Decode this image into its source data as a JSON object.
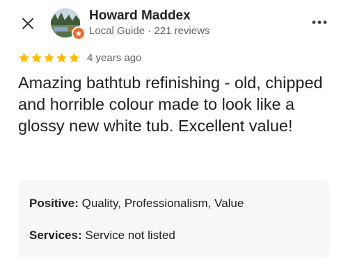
{
  "reviewer": {
    "name": "Howard Maddex",
    "meta": "Local Guide · 221 reviews"
  },
  "icons": {
    "close": "close-icon",
    "more": "more-vertical-icon",
    "badge": "local-guide-badge-icon",
    "star": "star-icon"
  },
  "colors": {
    "star": "#fbbc04",
    "badge": "#ee6a2b",
    "card_bg": "#f7f8f8"
  },
  "review": {
    "rating": 5,
    "max_rating": 5,
    "age": "4 years ago",
    "text": "Amazing bathtub refinishing - old, chipped and horrible colour made to look like a glossy new white tub. Excellent value!"
  },
  "attributes": {
    "positive_label": "Positive:",
    "positive_value": "Quality, Professionalism, Value",
    "services_label": "Services:",
    "services_value": "Service not listed"
  }
}
